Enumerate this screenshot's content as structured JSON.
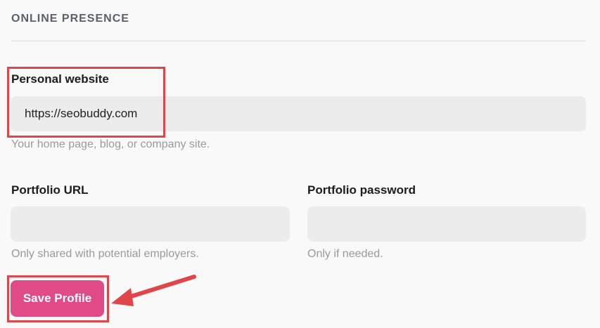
{
  "section": {
    "title": "ONLINE PRESENCE"
  },
  "personal_website": {
    "label": "Personal website",
    "value": "https://seobuddy.com",
    "help": "Your home page, blog, or company site."
  },
  "portfolio_url": {
    "label": "Portfolio URL",
    "value": "",
    "help": "Only shared with potential employers."
  },
  "portfolio_password": {
    "label": "Portfolio password",
    "value": "",
    "help": "Only if needed."
  },
  "actions": {
    "save_label": "Save Profile"
  },
  "colors": {
    "accent": "#e04a86",
    "annotation": "#e0454a"
  }
}
